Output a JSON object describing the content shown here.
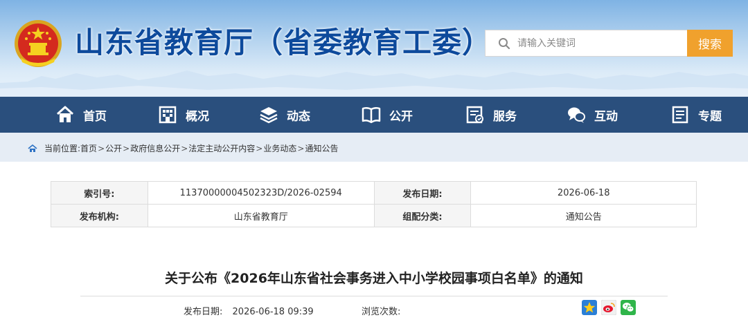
{
  "header": {
    "site_title": "山东省教育厅（省委教育工委）",
    "search_placeholder": "请输入关键词",
    "search_button": "搜索"
  },
  "nav": {
    "items": [
      {
        "label": "首页",
        "icon": "home-icon"
      },
      {
        "label": "概况",
        "icon": "building-icon"
      },
      {
        "label": "动态",
        "icon": "stack-icon"
      },
      {
        "label": "公开",
        "icon": "book-icon"
      },
      {
        "label": "服务",
        "icon": "service-icon"
      },
      {
        "label": "互动",
        "icon": "chat-icon"
      },
      {
        "label": "专题",
        "icon": "document-icon"
      }
    ]
  },
  "breadcrumb": {
    "prefix": "当前位置: ",
    "items": [
      "首页",
      "公开",
      "政府信息公开",
      "法定主动公开内容",
      "业务动态",
      "通知公告"
    ],
    "separator": ">"
  },
  "meta_table": {
    "rows": [
      {
        "label1": "索引号:",
        "value1": "11370000004502323D/2026-02594",
        "label2": "发布日期:",
        "value2": "2026-06-18"
      },
      {
        "label1": "发布机构:",
        "value1": "山东省教育厅",
        "label2": "组配分类:",
        "value2": "通知公告"
      }
    ]
  },
  "article": {
    "title": "关于公布《2026年山东省社会事务进入中小学校园事项白名单》的通知",
    "pub_date_label": "发布日期:",
    "pub_date": "2026-06-18 09:39",
    "views_label": "浏览次数:"
  },
  "colors": {
    "title_blue": "#0d4a9c",
    "nav_bg": "#2a4f7d",
    "search_button": "#f0a12d",
    "breadcrumb_bg": "#e6edf5"
  },
  "share_icons": [
    "qzone-star-icon",
    "weibo-icon",
    "wechat-icon"
  ]
}
